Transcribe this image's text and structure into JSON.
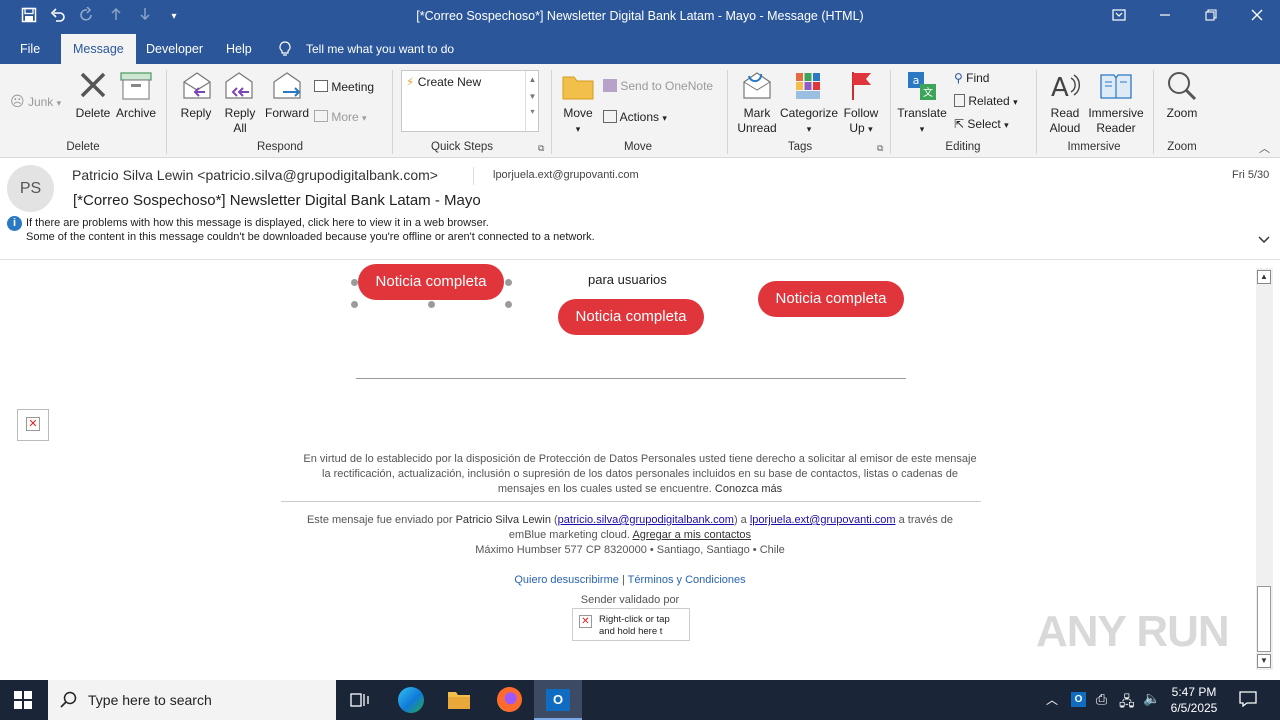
{
  "window": {
    "title": "[*Correo Sospechoso*] Newsletter Digital Bank Latam - Mayo  -  Message (HTML)"
  },
  "tabs": [
    {
      "label": "File"
    },
    {
      "label": "Message"
    },
    {
      "label": "Developer"
    },
    {
      "label": "Help"
    }
  ],
  "tell_me": "Tell me what you want to do",
  "ribbon": {
    "junk": "Junk",
    "delete": "Delete",
    "archive": "Archive",
    "group_delete": "Delete",
    "reply": "Reply",
    "reply_all_1": "Reply",
    "reply_all_2": "All",
    "forward": "Forward",
    "meeting": "Meeting",
    "more": "More",
    "group_respond": "Respond",
    "create_new": "Create New",
    "group_quick_steps": "Quick Steps",
    "move": "Move",
    "send_onenote": "Send to OneNote",
    "actions": "Actions",
    "group_move": "Move",
    "mark_unread_1": "Mark",
    "mark_unread_2": "Unread",
    "categorize": "Categorize",
    "follow_up_1": "Follow",
    "follow_up_2": "Up",
    "group_tags": "Tags",
    "translate": "Translate",
    "find": "Find",
    "related": "Related",
    "select": "Select",
    "group_editing": "Editing",
    "read_aloud_1": "Read",
    "read_aloud_2": "Aloud",
    "immersive_1": "Immersive",
    "immersive_2": "Reader",
    "group_immersive": "Immersive",
    "zoom": "Zoom",
    "group_zoom": "Zoom"
  },
  "message": {
    "avatar_initials": "PS",
    "from": "Patricio Silva Lewin <patricio.silva@grupodigitalbank.com>",
    "to": "lporjuela.ext@grupovanti.com",
    "date": "Fri 5/30",
    "subject": "[*Correo Sospechoso*] Newsletter Digital Bank Latam - Mayo",
    "info_line_1": "If there are problems with how this message is displayed, click here to view it in a web browser.",
    "info_line_2": "Some of the content in this message couldn't be downloaded because you're offline or aren't connected to a network."
  },
  "body": {
    "btn1": "Noticia completa",
    "btn2": "Noticia completa",
    "btn3": "Noticia completa",
    "para_usuarios": "para usuarios",
    "legal_1": "En virtud de lo establecido por la disposición de Protección de Datos Personales usted tiene derecho a solicitar al emisor de este mensaje",
    "legal_2": "la rectificación, actualización, inclusión o supresión de los datos personales incluidos en su base de contactos, listas o cadenas de",
    "legal_3": "mensajes en los cuales usted se encuentre.",
    "legal_more": "Conozca más",
    "sent_prefix": "Este mensaje fue enviado por",
    "sent_name": "Patricio Silva Lewin",
    "sent_email": "patricio.silva@grupodigitalbank.com",
    "sent_a": "a",
    "sent_to": "lporjuela.ext@grupovanti.com",
    "sent_suffix": "a través de",
    "sent_via": "emBlue marketing cloud.",
    "add_contacts": "Agregar a mis contactos",
    "address": "Máximo Humbser 577 CP 8320000  • Santiago, Santiago • Chile",
    "unsubscribe": "Quiero desuscribirme",
    "terms": "Términos y Condiciones",
    "sender_validated": "Sender validado por",
    "broken_img_1": "Right-click or tap",
    "broken_img_2": "and hold here t"
  },
  "taskbar": {
    "search_placeholder": "Type here to search",
    "time": "5:47 PM",
    "date": "6/5/2025"
  },
  "watermark": "ANY RUN",
  "colors": {
    "brand": "#2b579a",
    "pill": "#e0353b",
    "taskbar": "#1a2538"
  }
}
